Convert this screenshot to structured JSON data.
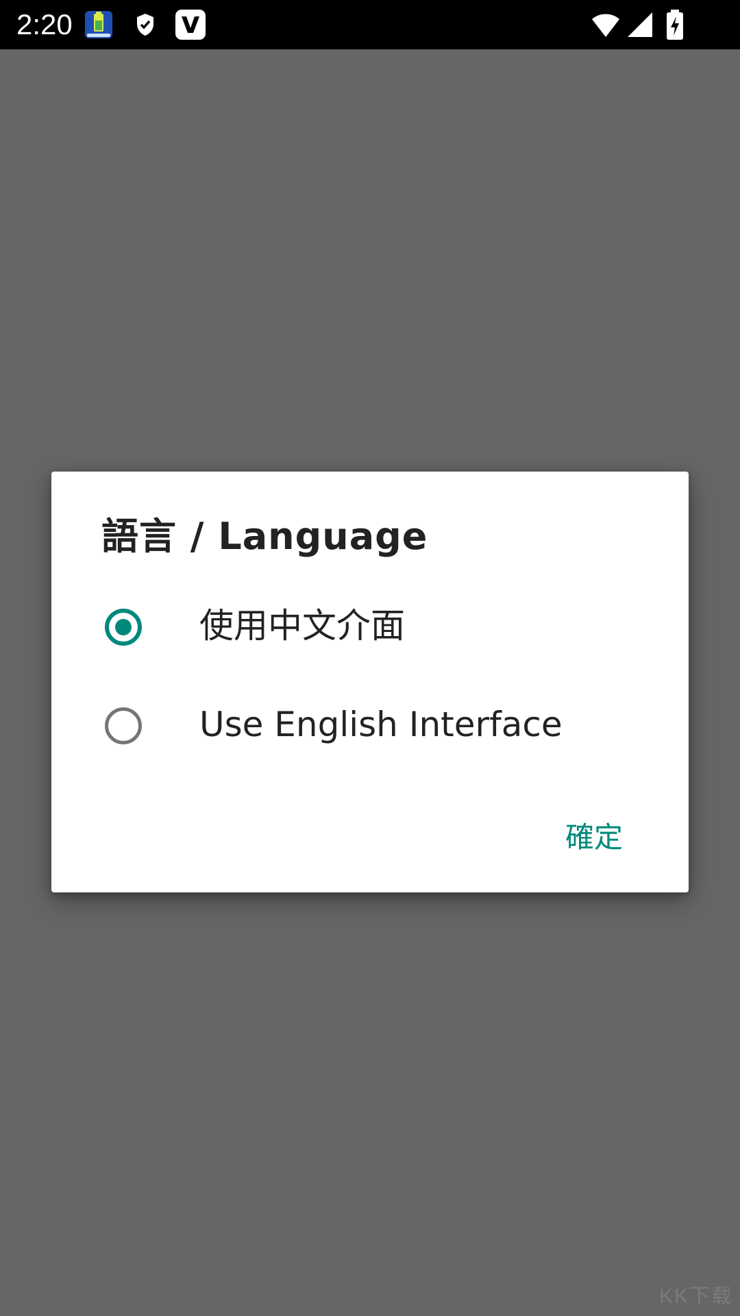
{
  "status_bar": {
    "time": "2:20",
    "icons": [
      "battery-app-icon",
      "shield-icon",
      "v-app-icon",
      "wifi-icon",
      "signal-icon",
      "battery-charging-icon"
    ]
  },
  "dialog": {
    "title": "語言 / Language",
    "options": [
      {
        "label": "使用中文介面",
        "selected": true
      },
      {
        "label": "Use English Interface",
        "selected": false
      }
    ],
    "confirm_label": "確定"
  },
  "watermark": "KK下载",
  "colors": {
    "accent": "#00897b",
    "scrim": "#666666",
    "status_bar": "#000000"
  }
}
